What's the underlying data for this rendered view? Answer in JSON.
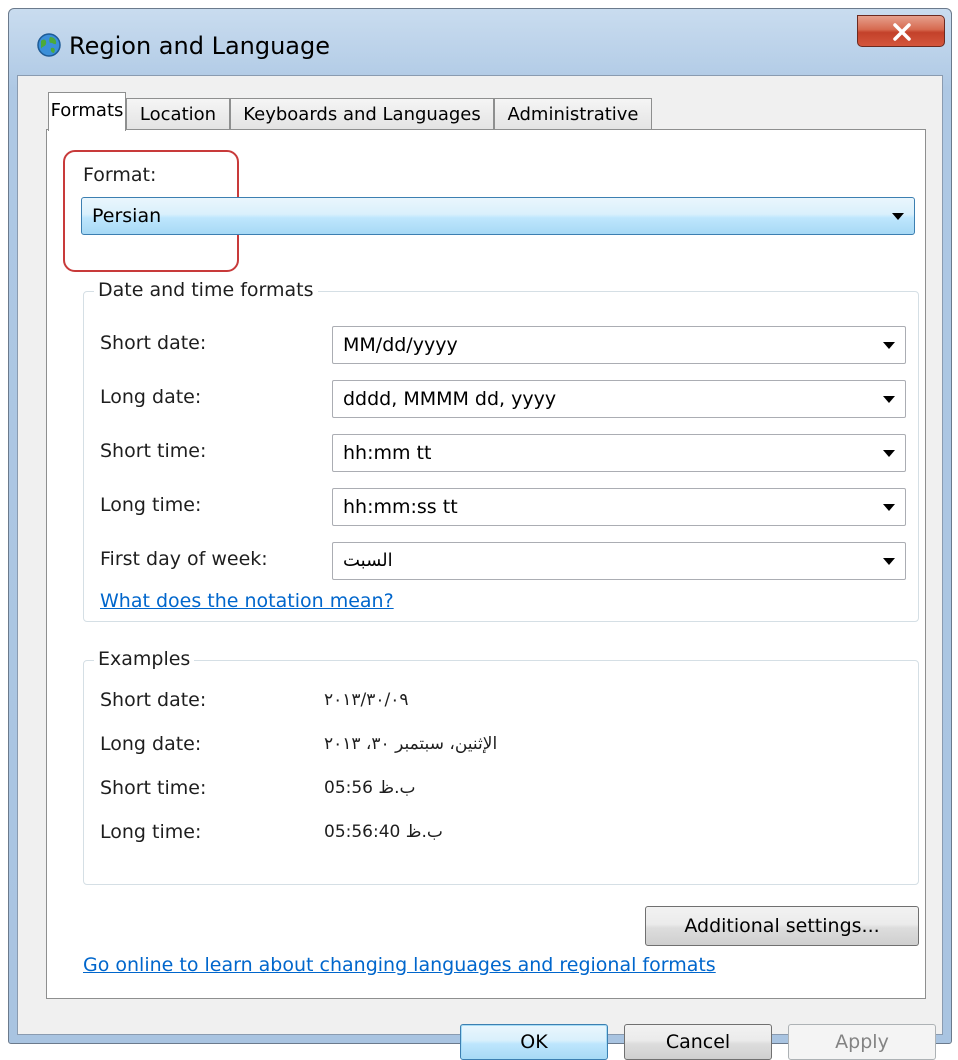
{
  "window": {
    "title": "Region and Language",
    "icon": "globe-icon",
    "close_icon": "close-icon"
  },
  "tabs": [
    {
      "label": "Formats",
      "active": true
    },
    {
      "label": "Location",
      "active": false
    },
    {
      "label": "Keyboards and Languages",
      "active": false
    },
    {
      "label": "Administrative",
      "active": false
    }
  ],
  "format": {
    "label": "Format:",
    "value": "Persian"
  },
  "date_time": {
    "group_title": "Date and time formats",
    "rows": [
      {
        "label": "Short date:",
        "value": "MM/dd/yyyy"
      },
      {
        "label": "Long date:",
        "value": "dddd, MMMM dd, yyyy"
      },
      {
        "label": "Short time:",
        "value": "hh:mm tt"
      },
      {
        "label": "Long time:",
        "value": "hh:mm:ss tt"
      },
      {
        "label": "First day of week:",
        "value": "السبت"
      }
    ],
    "notation_link": "What does the notation mean?"
  },
  "examples": {
    "group_title": "Examples",
    "rows": [
      {
        "label": "Short date:",
        "value": "٢٠١٣/٣٠/٠٩"
      },
      {
        "label": "Long date:",
        "value": "الإثنين، سبتمبر ٣٠، ٢٠١٣"
      },
      {
        "label": "Short time:",
        "value": "05:56 ب.ظ"
      },
      {
        "label": "Long time:",
        "value": "05:56:40 ب.ظ"
      }
    ]
  },
  "additional_settings_label": "Additional settings...",
  "online_link": "Go online to learn about changing languages and regional formats",
  "buttons": {
    "ok": "OK",
    "cancel": "Cancel",
    "apply": "Apply"
  },
  "colors": {
    "link": "#0066cc",
    "highlight_border": "#c83a3a",
    "selected_combo": "#bee6fd"
  }
}
